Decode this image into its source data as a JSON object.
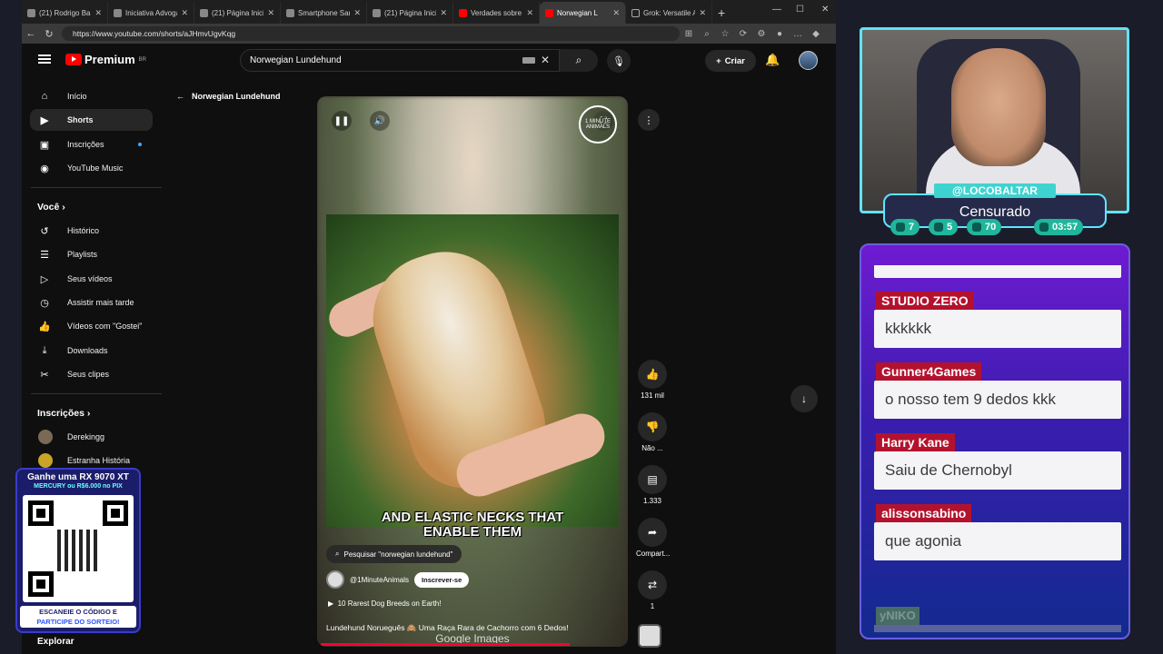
{
  "browser": {
    "tabs": [
      {
        "label": "(21) Rodrigo Balta",
        "favicon": "x-icon"
      },
      {
        "label": "Iniciativa Advogad",
        "favicon": "page-icon"
      },
      {
        "label": "(21) Página Inicial",
        "favicon": "x-icon"
      },
      {
        "label": "Smartphone Sams",
        "favicon": "page-icon"
      },
      {
        "label": "(21) Página Inicial",
        "favicon": "x-icon"
      },
      {
        "label": "Verdades sobre ti",
        "favicon": "youtube-icon"
      },
      {
        "label": "Norwegian L",
        "favicon": "youtube-icon",
        "active": true
      },
      {
        "label": "Grok: Versatile AI",
        "favicon": "grok-icon"
      }
    ],
    "url": "https://www.youtube.com/shorts/aJHmvUgvKqg"
  },
  "youtube": {
    "logo_text": "Premium",
    "logo_region": "BR",
    "search_value": "Norwegian Lundehund",
    "create_label": "Criar",
    "sidebar": {
      "main": [
        {
          "label": "Início",
          "icon": "home-icon"
        },
        {
          "label": "Shorts",
          "icon": "shorts-icon",
          "active": true
        },
        {
          "label": "Inscrições",
          "icon": "subscriptions-icon",
          "dot": true
        },
        {
          "label": "YouTube Music",
          "icon": "music-icon"
        }
      ],
      "you_header": "Você",
      "you": [
        {
          "label": "Histórico",
          "icon": "history-icon"
        },
        {
          "label": "Playlists",
          "icon": "playlists-icon"
        },
        {
          "label": "Seus vídeos",
          "icon": "your-videos-icon"
        },
        {
          "label": "Assistir mais tarde",
          "icon": "watch-later-icon"
        },
        {
          "label": "Vídeos com \"Gostei\"",
          "icon": "like-icon"
        },
        {
          "label": "Downloads",
          "icon": "download-icon"
        },
        {
          "label": "Seus clipes",
          "icon": "clips-icon"
        }
      ],
      "subs_header": "Inscrições",
      "subs": [
        {
          "label": "Derekingg"
        },
        {
          "label": "Estranha História"
        }
      ],
      "explore_header": "Explorar"
    },
    "short": {
      "back_title": "Norwegian Lundehund",
      "caption_line1": "AND ELASTIC NECKS THAT",
      "caption_line2": "ENABLE THEM",
      "search_chip": "Pesquisar \"norwegian lundehund\"",
      "channel": "@1MinuteAnimals",
      "subscribe_label": "Inscrever-se",
      "playlist": "10 Rarest Dog Breeds on Earth!",
      "title": "Lundehund Norueguês 🙈 Uma Raça Rara de Cachorro com 6 Dedos!",
      "watermark": "Google Images",
      "channel_logo_text": "1 MINUTE ANIMALS",
      "progress": 0.82
    },
    "actions": {
      "likes": "131 mil",
      "dislike": "Não ...",
      "comments": "1.333",
      "share": "Compart...",
      "remix": "1"
    }
  },
  "overlay_qr": {
    "title": "Ganhe uma RX 9070 XT",
    "subtitle": "MERCURY ou R$6.000 no PIX",
    "cta_line1": "ESCANEIE O CÓDIGO E",
    "cta_line2": "PARTICIPE DO SORTEIO!"
  },
  "stream": {
    "handle": "@LOCOBALTAR",
    "status": "Censurado",
    "stats": [
      {
        "icon": "twitch-icon",
        "value": "7"
      },
      {
        "icon": "youtube-icon",
        "value": "5"
      },
      {
        "icon": "kick-icon",
        "value": "70"
      },
      {
        "icon": "clock-icon",
        "value": "03:57"
      }
    ],
    "chat": [
      {
        "user": "STUDIO ZERO",
        "text": "kkkkkk"
      },
      {
        "user": "Gunner4Games",
        "text": "o nosso tem 9 dedos kkk"
      },
      {
        "user": "Harry Kane",
        "text": "Saiu de Chernobyl"
      },
      {
        "user": "alissonsabino",
        "text": "que agonia"
      }
    ],
    "pending_user": "yNIKO"
  }
}
